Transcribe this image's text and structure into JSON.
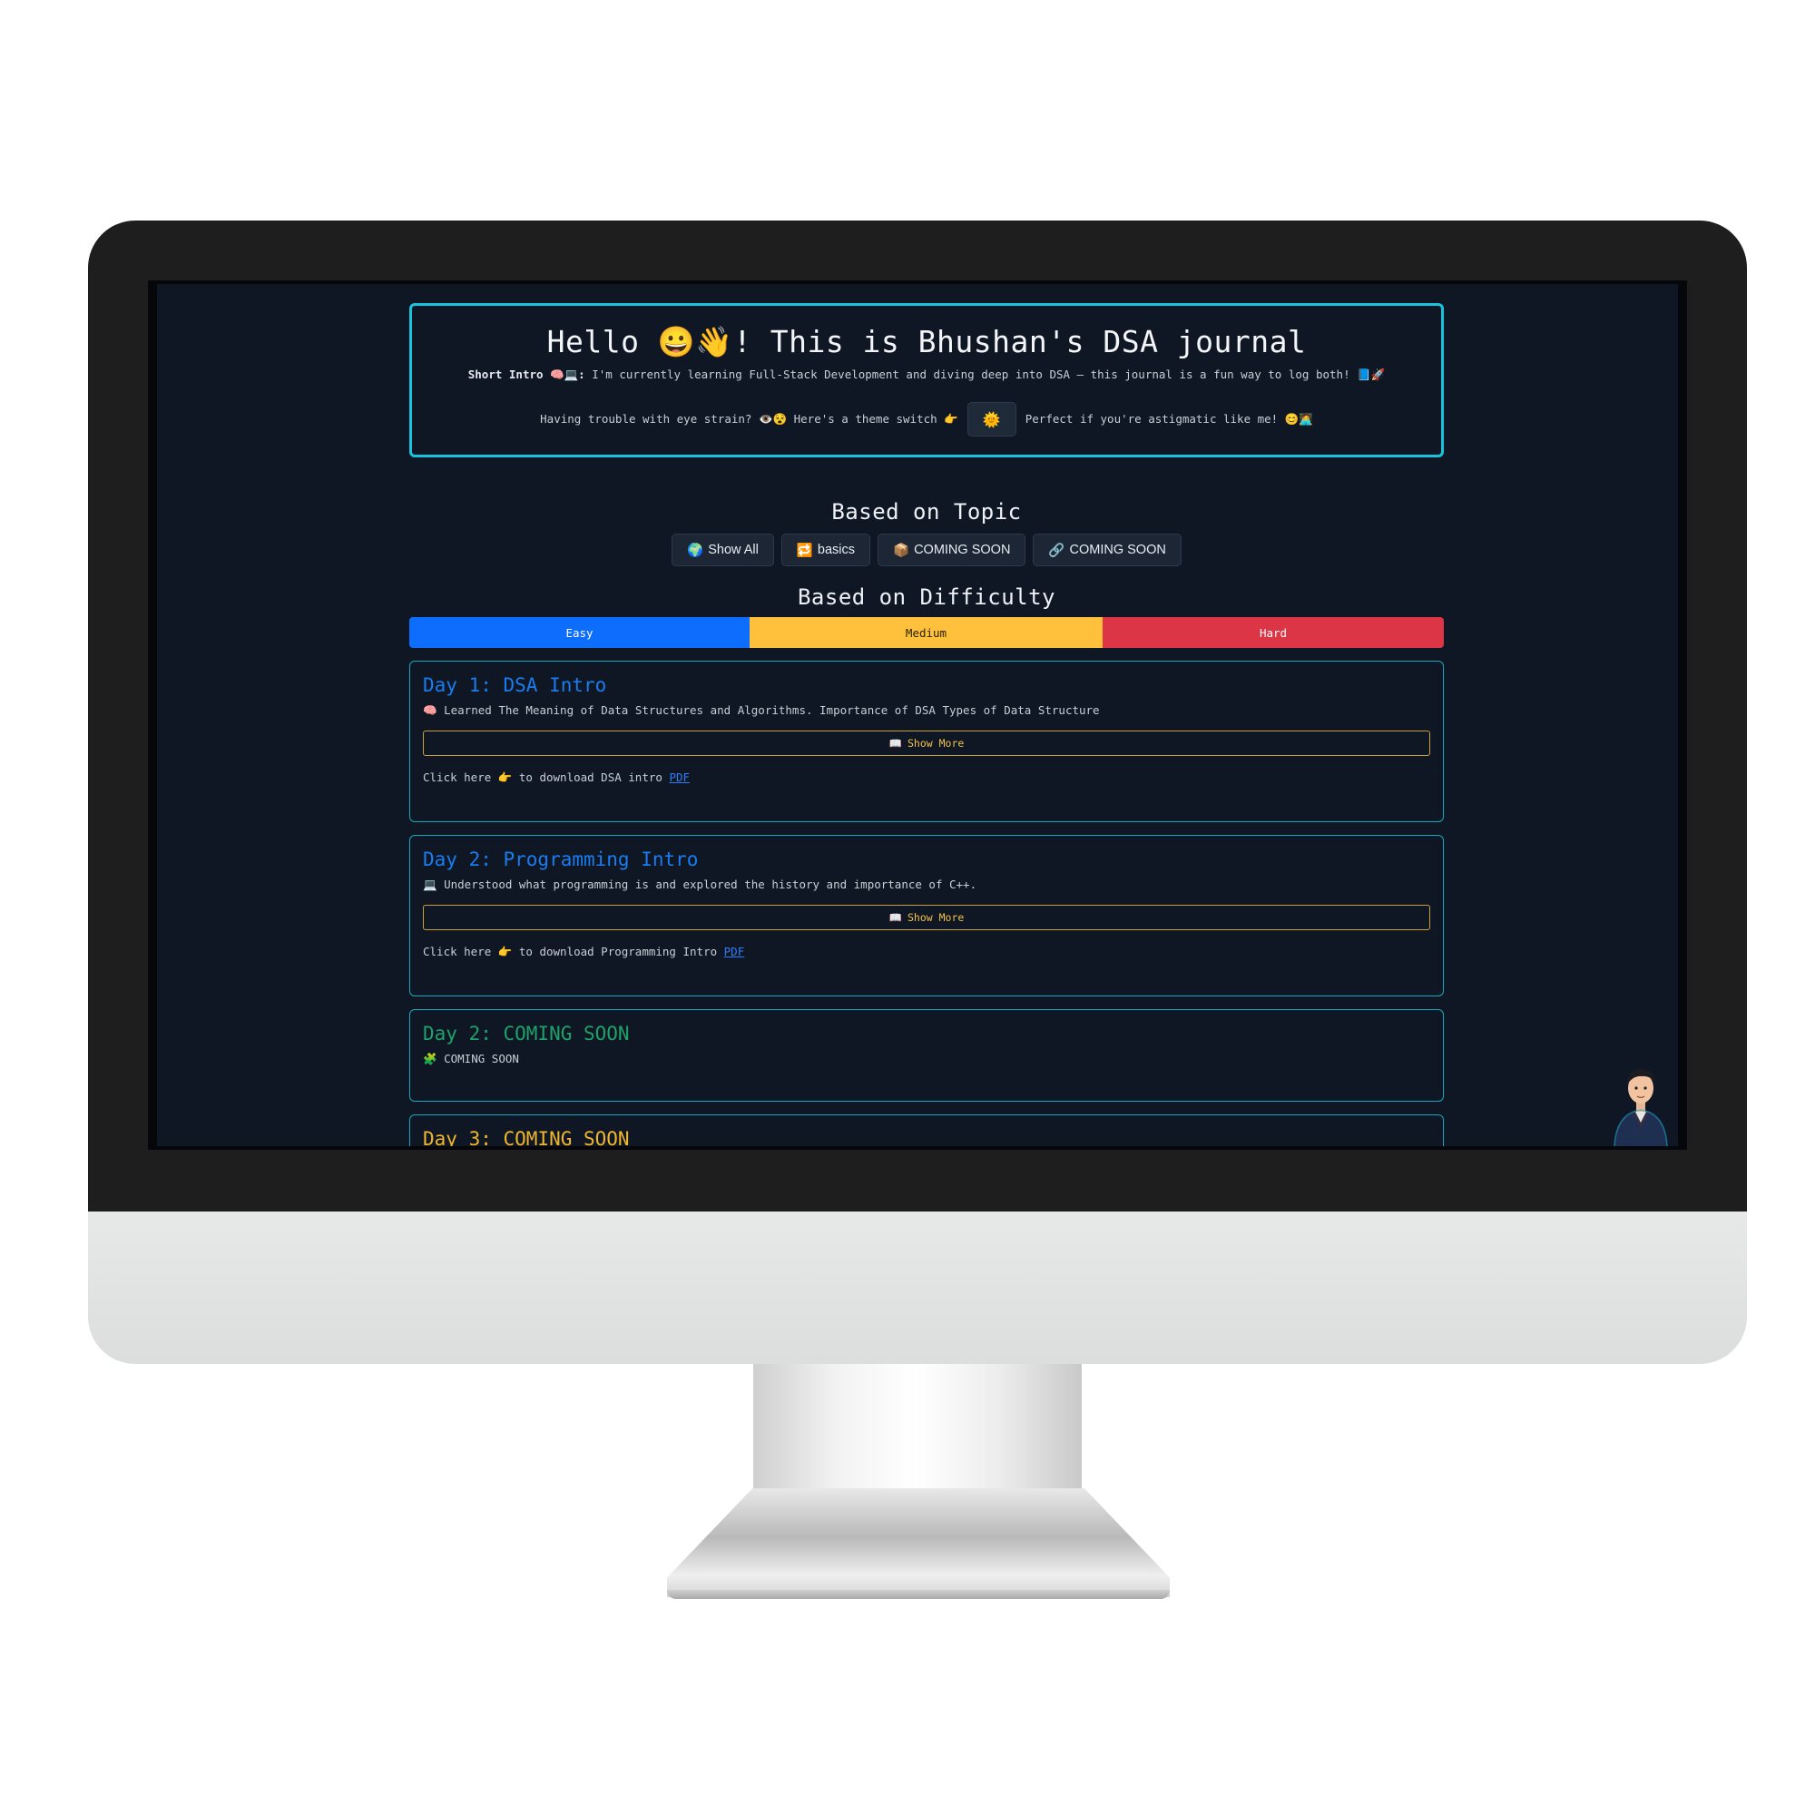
{
  "header": {
    "title": "Hello 😀👋! This is Bhushan's DSA journal",
    "intro_label": "Short Intro 🧠💻:",
    "intro_text": " I'm currently learning Full-Stack Development and diving deep into DSA – this journal is a fun way to log both! 📘🚀",
    "eye_strain_text": "Having trouble with eye strain? 👁️😵 Here's a theme switch 👉",
    "theme_toggle_icon": "🌞",
    "astigmatic_text": "Perfect if you're astigmatic like me! 😊🧑‍💻"
  },
  "topic": {
    "heading": "Based on Topic",
    "buttons": [
      {
        "icon": "🌍",
        "label": "Show All"
      },
      {
        "icon": "🔁",
        "label": "basics"
      },
      {
        "icon": "📦",
        "label": "COMING SOON"
      },
      {
        "icon": "🔗",
        "label": "COMING SOON"
      }
    ]
  },
  "difficulty": {
    "heading": "Based on Difficulty",
    "levels": [
      "Easy",
      "Medium",
      "Hard"
    ],
    "colors": {
      "easy": "#0d6efd",
      "medium": "#ffc13b",
      "hard": "#dc3545"
    }
  },
  "days": [
    {
      "title": "Day 1: DSA Intro",
      "icon": "🧠",
      "description": "Learned The Meaning of Data Structures and Algorithms. Importance of DSA Types of Data Structure",
      "show_more_icon": "📖",
      "show_more_label": "Show More",
      "download_text": "Click here 👉 to download DSA intro ",
      "pdf_label": "PDF"
    },
    {
      "title": "Day 2: Programming Intro",
      "icon": "💻",
      "description": "Understood what programming is and explored the history and importance of C++.",
      "show_more_icon": "📖",
      "show_more_label": "Show More",
      "download_text": "Click here 👉 to download Programming Intro ",
      "pdf_label": "PDF"
    },
    {
      "title": "Day 2: COMING SOON",
      "icon": "🧩",
      "description": "COMING SOON"
    },
    {
      "title": "Day 3: COMING SOON"
    }
  ]
}
